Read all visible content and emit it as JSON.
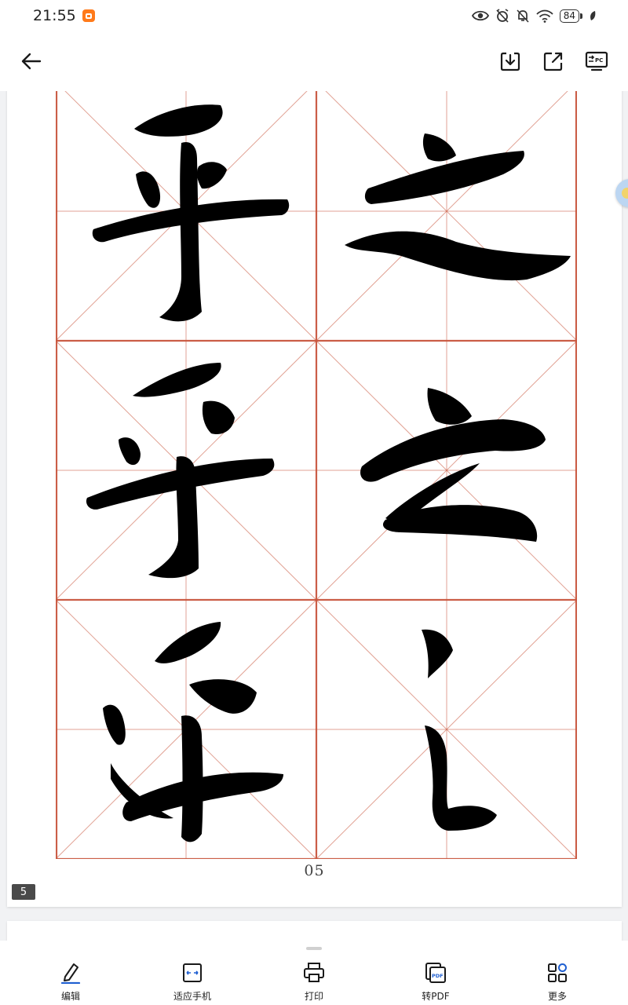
{
  "status_bar": {
    "time": "21:55",
    "battery": "84",
    "icons": [
      "app-notification-icon",
      "eye-icon",
      "alarm-off-icon",
      "bell-muted-icon",
      "wifi-icon",
      "battery-icon",
      "leaf-icon"
    ]
  },
  "app_bar": {
    "icons": [
      "back-arrow-icon",
      "download-icon",
      "share-external-icon",
      "send-to-pc-icon"
    ],
    "pc_label": "PC"
  },
  "document": {
    "page_number": "05",
    "page_index": "5",
    "grid_line_color": "#c8553d",
    "ink_color": "#000000"
  },
  "toolbar": {
    "items": [
      {
        "label": "编辑",
        "icon": "edit-pencil-icon"
      },
      {
        "label": "适应手机",
        "icon": "fit-phone-icon"
      },
      {
        "label": "打印",
        "icon": "printer-icon"
      },
      {
        "label": "转PDF",
        "icon": "pdf-convert-icon"
      },
      {
        "label": "更多",
        "icon": "more-grid-icon"
      }
    ],
    "pdf_badge": "PDF",
    "accent": "#1f5fd1"
  }
}
